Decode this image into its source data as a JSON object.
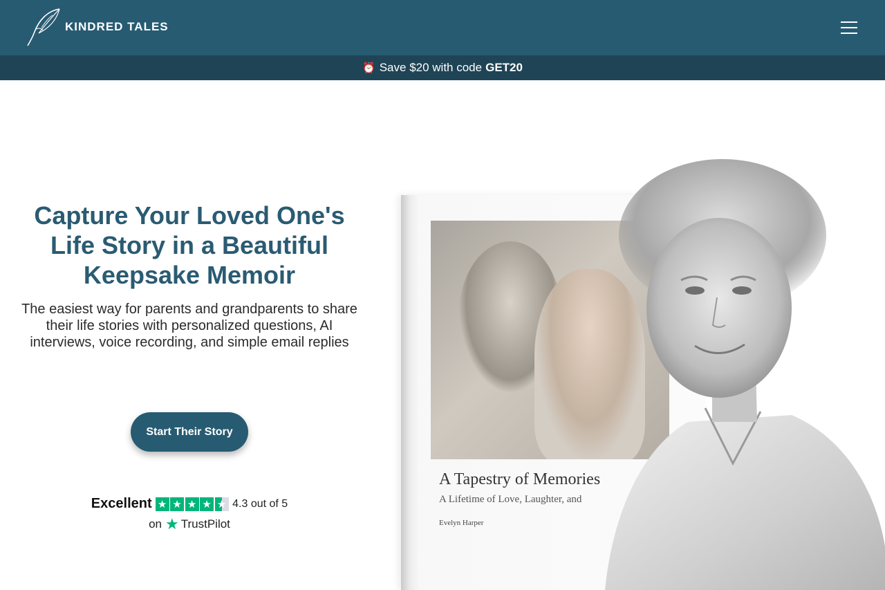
{
  "header": {
    "brand": "KINDRED TALES",
    "logo_icon": "quill-feather-icon",
    "menu_icon": "hamburger-menu-icon",
    "background_color": "#275b72"
  },
  "promo": {
    "icon": "alarm-clock-icon",
    "text": "Save $20 with code",
    "code": "GET20",
    "background_color": "#1e4456"
  },
  "hero": {
    "title": "Capture Your Loved One's Life Story in a Beautiful Keepsake Memoir",
    "subtitle": "The easiest way for parents and grandparents to share their life stories with personalized questions, AI interviews, voice recording,  and simple email replies",
    "cta_label": "Start Their Story",
    "title_color": "#2a5b72"
  },
  "rating": {
    "label": "Excellent",
    "stars_value": 4.3,
    "stars_max": 5,
    "score_text": "4.3 out of 5",
    "on_text": "on",
    "provider": "TrustPilot",
    "star_color": "#00b67a"
  },
  "book": {
    "title": "A Tapestry of Memories",
    "subtitle": "A Lifetime of Love, Laughter, and",
    "author": "Evelyn Harper"
  }
}
